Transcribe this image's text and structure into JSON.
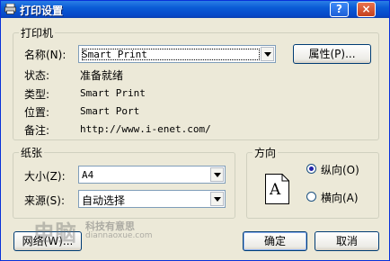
{
  "window": {
    "title": "打印设置",
    "help_glyph": "?",
    "close_glyph": "×"
  },
  "printer": {
    "legend": "打印机",
    "name_label": "名称(N):",
    "name_value": "Smart Print",
    "properties_button": "属性(P)...",
    "status_label": "状态:",
    "status_value": "准备就绪",
    "type_label": "类型:",
    "type_value": "Smart Print",
    "where_label": "位置:",
    "where_value": "Smart Port",
    "comment_label": "备注:",
    "comment_value": "http://www.i-enet.com/"
  },
  "paper": {
    "legend": "纸张",
    "size_label": "大小(Z):",
    "size_value": "A4",
    "source_label": "来源(S):",
    "source_value": "自动选择"
  },
  "orientation": {
    "legend": "方向",
    "icon_letter": "A",
    "portrait_label": "纵向(O)",
    "landscape_label": "横向(A)",
    "selected": "portrait"
  },
  "buttons": {
    "network": "网络(W)...",
    "ok": "确定",
    "cancel": "取消"
  },
  "watermark": {
    "logo": "电脑",
    "text": "科技有意思",
    "url": "diannaoxue.com"
  }
}
